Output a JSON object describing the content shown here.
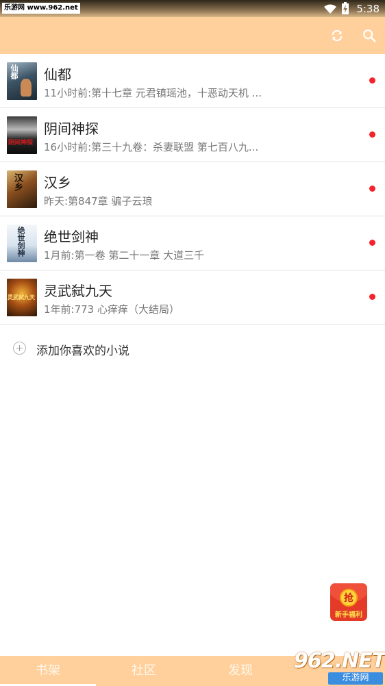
{
  "status_bar": {
    "watermark": "乐游网 www.962.net",
    "time": "5:38"
  },
  "app_bar": {
    "refresh_icon": "refresh-icon",
    "search_icon": "search-icon"
  },
  "books": [
    {
      "title": "仙都",
      "subtitle": "11小时前:第十七章 元君镇瑶池，十恶动天机 ...",
      "cover_text": "仙都",
      "unread": true
    },
    {
      "title": "阴间神探",
      "subtitle": "16小时前:第三十九卷：杀妻联盟 第七百八九...",
      "cover_text": "阴间神探",
      "unread": true
    },
    {
      "title": "汉乡",
      "subtitle": "昨天:第847章 骗子云琅",
      "cover_text": "汉乡",
      "unread": true
    },
    {
      "title": "绝世剑神",
      "subtitle": "1月前:第一卷 第二十一章 大道三千",
      "cover_text": "绝世剑神",
      "unread": true
    },
    {
      "title": "灵武弑九天",
      "subtitle": "1年前:773 心痒痒（大结局）",
      "cover_text": "灵武弑九天",
      "unread": true
    }
  ],
  "add_novel": {
    "label": "添加你喜欢的小说"
  },
  "red_packet": {
    "coin_text": "抢",
    "label": "新手福利"
  },
  "tabs": [
    {
      "label": "书架",
      "active": true
    },
    {
      "label": "社区",
      "active": false
    },
    {
      "label": "发现",
      "active": false
    }
  ],
  "bottom_watermark": {
    "brand": "962.NET",
    "sub": "乐游网"
  },
  "colors": {
    "accent": "#ffd09c",
    "unread_dot": "#f5232b",
    "tab_text": "#fff7ea"
  }
}
